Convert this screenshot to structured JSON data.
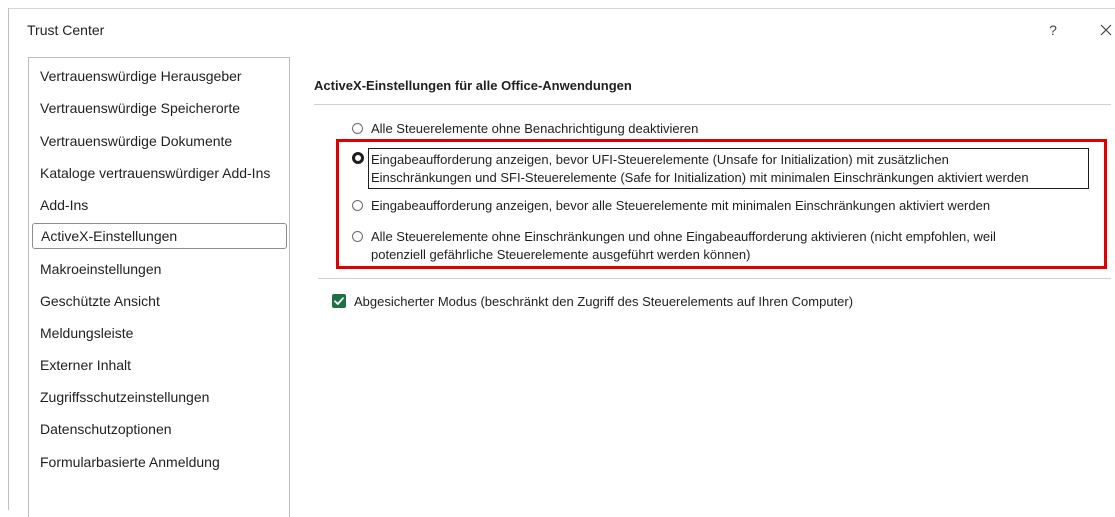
{
  "dialog": {
    "title": "Trust Center",
    "help_label": "?"
  },
  "sidebar": {
    "items": [
      {
        "label": "Vertrauenswürdige Herausgeber"
      },
      {
        "label": "Vertrauenswürdige Speicherorte"
      },
      {
        "label": "Vertrauenswürdige Dokumente"
      },
      {
        "label": "Kataloge vertrauenswürdiger Add-Ins"
      },
      {
        "label": "Add-Ins"
      },
      {
        "label": "ActiveX-Einstellungen",
        "selected": true
      },
      {
        "label": "Makroeinstellungen"
      },
      {
        "label": "Geschützte Ansicht"
      },
      {
        "label": "Meldungsleiste"
      },
      {
        "label": "Externer Inhalt"
      },
      {
        "label": "Zugriffsschutzeinstellungen"
      },
      {
        "label": "Datenschutzoptionen"
      },
      {
        "label": "Formularbasierte Anmeldung"
      }
    ]
  },
  "main": {
    "section_title": "ActiveX-Einstellungen für alle Office-Anwendungen",
    "options": [
      {
        "checked": false,
        "line1": "Alle Steuerelemente ohne Benachrichtigung deaktivieren"
      },
      {
        "checked": true,
        "line1": "Eingabeaufforderung anzeigen, bevor UFI-Steuerelemente (Unsafe for Initialization) mit zusätzlichen",
        "line2": "Einschränkungen und SFI-Steuerelemente (Safe for Initialization) mit minimalen Einschränkungen aktiviert werden"
      },
      {
        "checked": false,
        "line1": "Eingabeaufforderung anzeigen, bevor alle Steuerelemente mit minimalen Einschränkungen aktiviert werden"
      },
      {
        "checked": false,
        "line1": "Alle Steuerelemente ohne Einschränkungen und ohne Eingabeaufforderung aktivieren (nicht empfohlen, weil",
        "line2": "potenziell gefährliche Steuerelemente ausgeführt werden können)"
      }
    ],
    "safe_mode": {
      "checked": true,
      "label": "Abgesicherter Modus (beschränkt den Zugriff des Steuerelements auf Ihren Computer)"
    }
  },
  "colors": {
    "highlight_border": "#e00000",
    "checkbox_fill": "#1e7145"
  }
}
